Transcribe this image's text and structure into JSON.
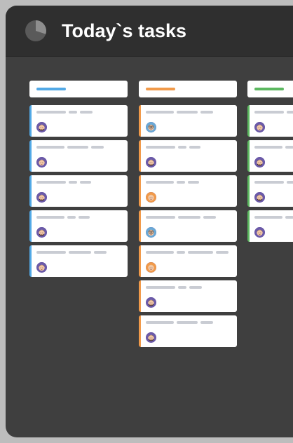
{
  "header": {
    "title": "Today`s tasks",
    "icon": "pie-chart-icon"
  },
  "colors": {
    "window_bg": "#3f3f3f",
    "header_bg": "#2f2f2f",
    "blue": "#52a9e6",
    "orange": "#f19a4a",
    "green": "#5cb860",
    "skeleton": "#c9ccd3"
  },
  "columns": [
    {
      "name": "blue",
      "color": "#52a9e6",
      "cards": [
        {
          "avatar": "beard-avatar-icon",
          "bg": "#6b5aa8"
        },
        {
          "avatar": "woman-avatar-icon",
          "bg": "#6b5aa8"
        },
        {
          "avatar": "beard-avatar-icon",
          "bg": "#6b5aa8"
        },
        {
          "avatar": "beard-avatar-icon",
          "bg": "#6b5aa8"
        },
        {
          "avatar": "woman-avatar-icon",
          "bg": "#6b5aa8"
        }
      ]
    },
    {
      "name": "orange",
      "color": "#f19a4a",
      "cards": [
        {
          "avatar": "glasses-avatar-icon",
          "bg": "#6aa9d6"
        },
        {
          "avatar": "beard-avatar-icon",
          "bg": "#6b5aa8"
        },
        {
          "avatar": "blonde-avatar-icon",
          "bg": "#f19a4a"
        },
        {
          "avatar": "glasses-avatar-icon",
          "bg": "#6aa9d6"
        },
        {
          "avatar": "blonde-avatar-icon",
          "bg": "#f19a4a"
        },
        {
          "avatar": "beard-avatar-icon",
          "bg": "#6b5aa8"
        },
        {
          "avatar": "beard-avatar-icon",
          "bg": "#6b5aa8"
        }
      ]
    },
    {
      "name": "green",
      "color": "#5cb860",
      "cards": [
        {
          "avatar": "woman-avatar-icon",
          "bg": "#6b5aa8"
        },
        {
          "avatar": "beard-avatar-icon",
          "bg": "#6b5aa8"
        },
        {
          "avatar": "beard-avatar-icon",
          "bg": "#6b5aa8"
        },
        {
          "avatar": "woman-avatar-icon",
          "bg": "#6b5aa8"
        }
      ]
    }
  ]
}
